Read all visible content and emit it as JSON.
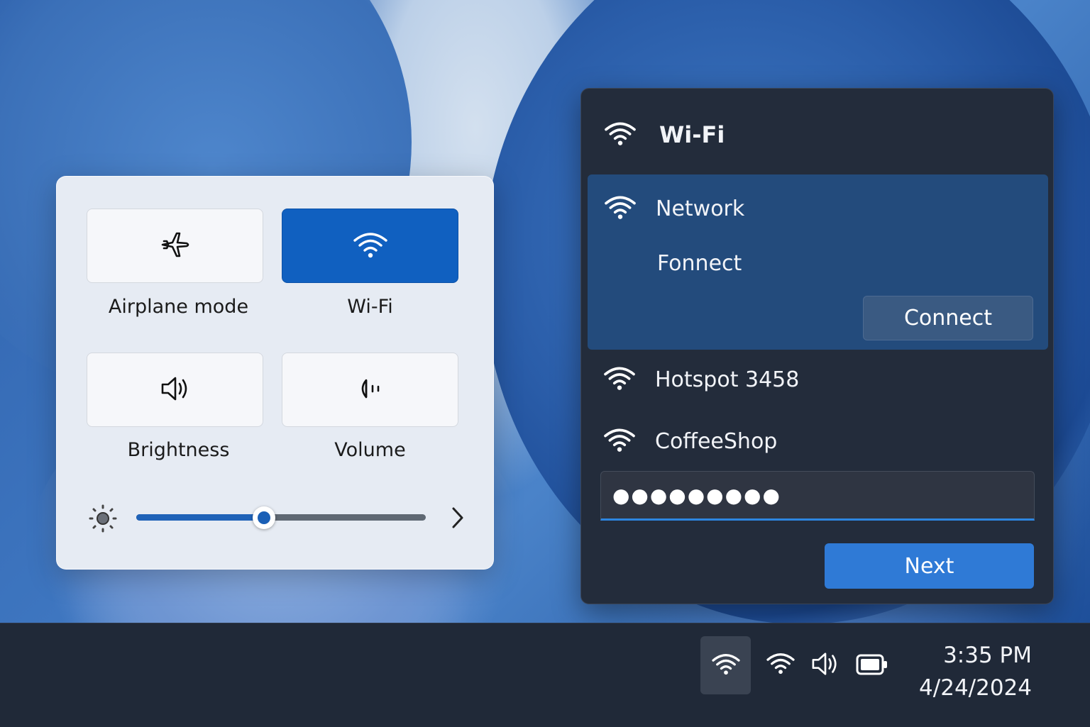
{
  "quick_settings": {
    "tiles": [
      {
        "label": "Airplane mode",
        "icon": "airplane-icon",
        "active": false
      },
      {
        "label": "Wi-Fi",
        "icon": "wifi-icon",
        "active": true
      },
      {
        "label": "Brightness",
        "icon": "speaker-icon",
        "active": false
      },
      {
        "label": "Volume",
        "icon": "volume-icon",
        "active": false
      }
    ],
    "brightness_slider": {
      "value": 0.44,
      "icon": "sun-icon",
      "expand_icon": "chevron-right-icon"
    }
  },
  "wifi_panel": {
    "title": "Wi-Fi",
    "selected_network": {
      "name": "Network",
      "subtitle": "Fonnect",
      "connect_label": "Connect"
    },
    "networks": [
      {
        "name": "Hotspot 3458"
      },
      {
        "name": "CoffeeShop"
      }
    ],
    "password_value": "●●●●●●●●●",
    "next_label": "Next"
  },
  "taskbar": {
    "tray_icons": [
      "wifi-icon",
      "wifi-icon",
      "speaker-icon",
      "battery-icon"
    ],
    "time": "3:35 PM",
    "date": "4/24/2024"
  },
  "colors": {
    "accent": "#1060c0",
    "panel_dark": "#232c3b",
    "selected_row": "#234b7c",
    "next_button": "#2f7ad6",
    "taskbar": "#202938"
  }
}
